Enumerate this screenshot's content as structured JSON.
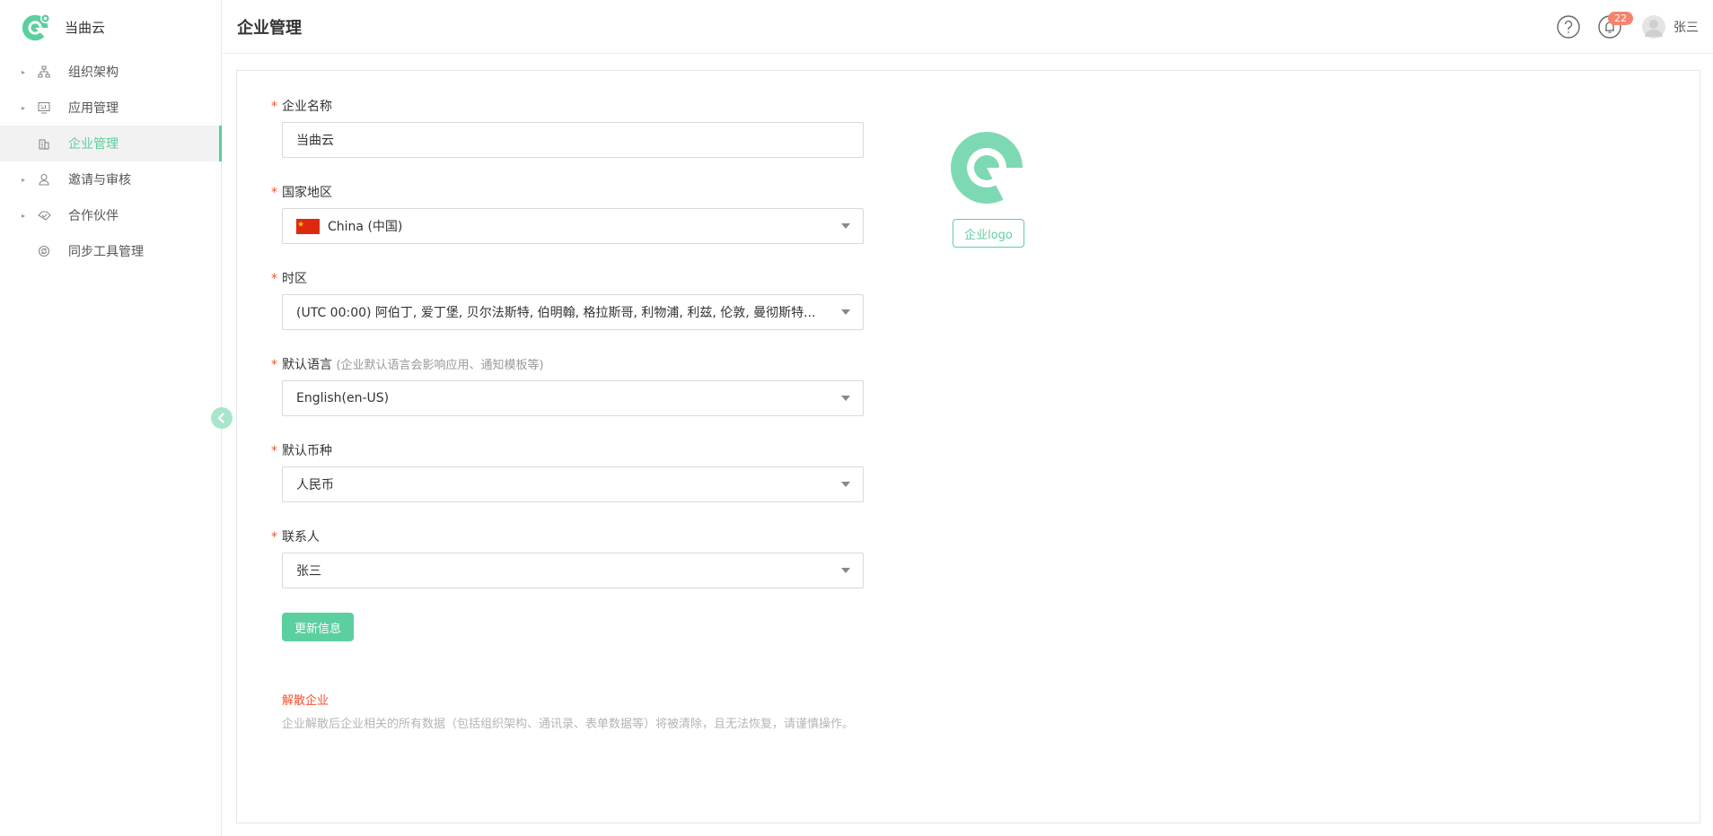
{
  "brand": {
    "name": "当曲云",
    "logo_icon": "brand-logo-icon",
    "accent_color": "#5ccf9f"
  },
  "sidebar": {
    "items": [
      {
        "label": "组织架构",
        "icon": "org-chart-icon",
        "expandable": true,
        "active": false
      },
      {
        "label": "应用管理",
        "icon": "app-icon",
        "expandable": true,
        "active": false
      },
      {
        "label": "企业管理",
        "icon": "building-icon",
        "expandable": false,
        "active": true
      },
      {
        "label": "邀请与审核",
        "icon": "user-icon",
        "expandable": true,
        "active": false
      },
      {
        "label": "合作伙伴",
        "icon": "handshake-icon",
        "expandable": true,
        "active": false
      },
      {
        "label": "同步工具管理",
        "icon": "sync-icon",
        "expandable": false,
        "active": false
      }
    ]
  },
  "header": {
    "title": "企业管理",
    "notification_count": "22",
    "username": "张三"
  },
  "form": {
    "company_name": {
      "label": "企业名称",
      "value": "当曲云"
    },
    "region": {
      "label": "国家地区",
      "value": "China (中国)",
      "flag": "china-flag-icon"
    },
    "timezone": {
      "label": "时区",
      "value": "(UTC 00:00) 阿伯丁, 爱丁堡, 贝尔法斯特, 伯明翰, 格拉斯哥, 利物浦, 利兹, 伦敦, 曼彻斯特..."
    },
    "language": {
      "label": "默认语言",
      "hint": "(企业默认语言会影响应用、通知模板等)",
      "value": "English(en-US)"
    },
    "currency": {
      "label": "默认币种",
      "value": "人民币"
    },
    "contact": {
      "label": "联系人",
      "value": "张三"
    },
    "submit_label": "更新信息",
    "required_mark": "*"
  },
  "logo": {
    "button_label": "企业logo"
  },
  "danger": {
    "dissolve_label": "解散企业",
    "description": "企业解散后企业相关的所有数据（包括组织架构、通讯录、表单数据等）将被清除，且无法恢复，请谨慎操作。"
  }
}
